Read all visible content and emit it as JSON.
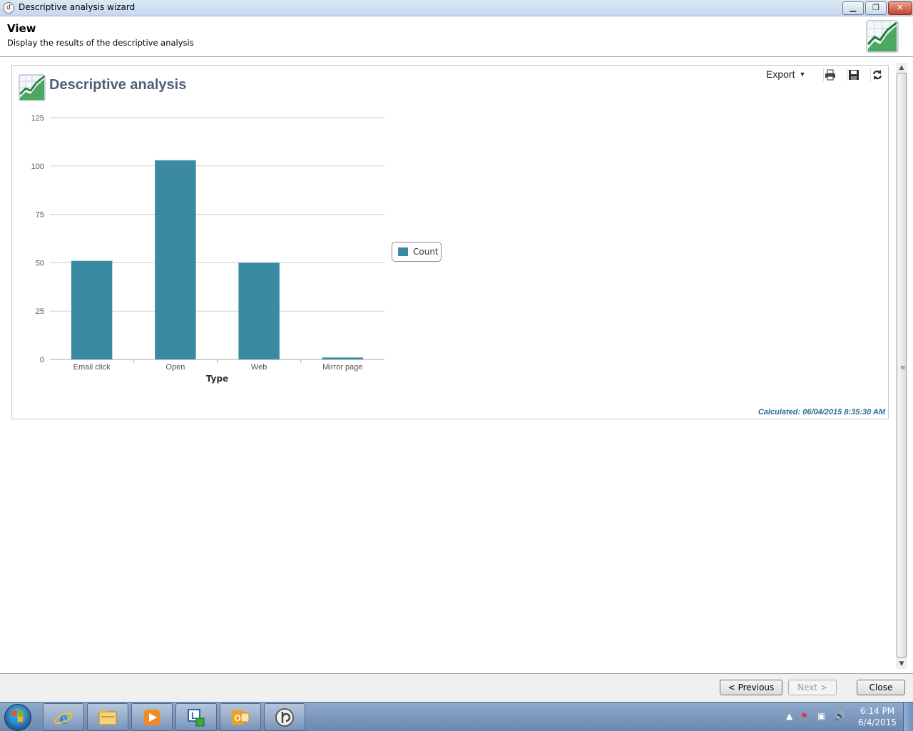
{
  "window": {
    "title": "Descriptive analysis wizard",
    "app_icon": "app-logo-icon"
  },
  "header": {
    "title": "View",
    "subtitle": "Display the results of the descriptive analysis",
    "icon": "chart-report-icon"
  },
  "report": {
    "title": "Descriptive analysis",
    "export_label": "Export",
    "toolbar_icons": [
      "print-icon",
      "save-icon",
      "refresh-icon"
    ],
    "calculated": "Calculated: 06/04/2015 8:35:30 AM"
  },
  "chart_data": {
    "type": "bar",
    "categories": [
      "Email click",
      "Open",
      "Web",
      "Mirror page"
    ],
    "series": [
      {
        "name": "Count",
        "values": [
          51,
          103,
          50,
          1
        ],
        "color": "#3b8aa4"
      }
    ],
    "title": "",
    "xlabel": "Type",
    "ylabel": "",
    "ylim": [
      0,
      125
    ],
    "yticks": [
      0,
      25,
      50,
      75,
      100,
      125
    ],
    "grid": true,
    "legend_position": "right"
  },
  "buttons": {
    "previous": "< Previous",
    "next": "Next >",
    "close": "Close"
  },
  "taskbar": {
    "apps": [
      "internet-explorer-icon",
      "file-explorer-icon",
      "media-player-icon",
      "network-app-icon",
      "outlook-icon",
      "wizard-app-icon"
    ],
    "time": "6:14 PM",
    "date": "6/4/2015"
  }
}
